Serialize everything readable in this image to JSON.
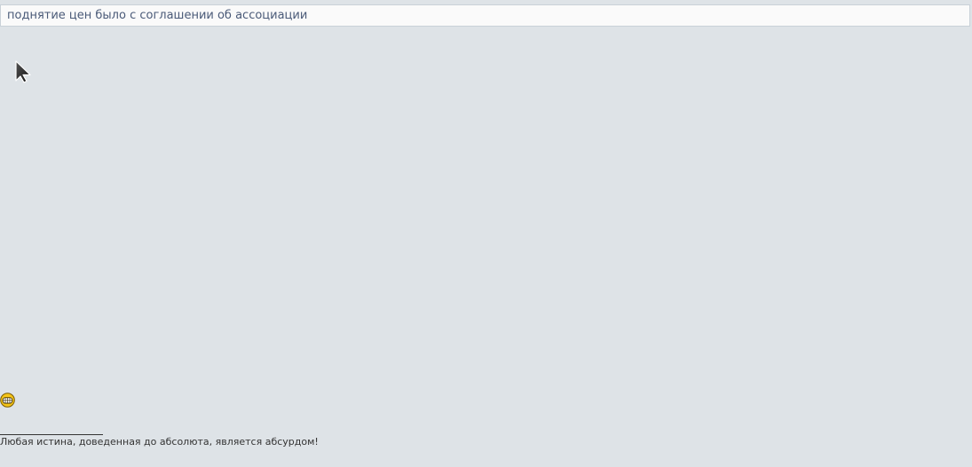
{
  "quote": {
    "text": "поднятие цен было с соглашении об ассоциации"
  },
  "icons": {
    "cursor": "mouse-pointer-icon",
    "smiley": "grin-smiley-icon"
  },
  "signature": {
    "text": "Любая истина, доведенная до абсолюта, является абсурдом!"
  },
  "colors": {
    "background": "#dee3e7",
    "quote_background": "#fafafa",
    "quote_text": "#4a5a78",
    "smiley": "#f5c518"
  }
}
